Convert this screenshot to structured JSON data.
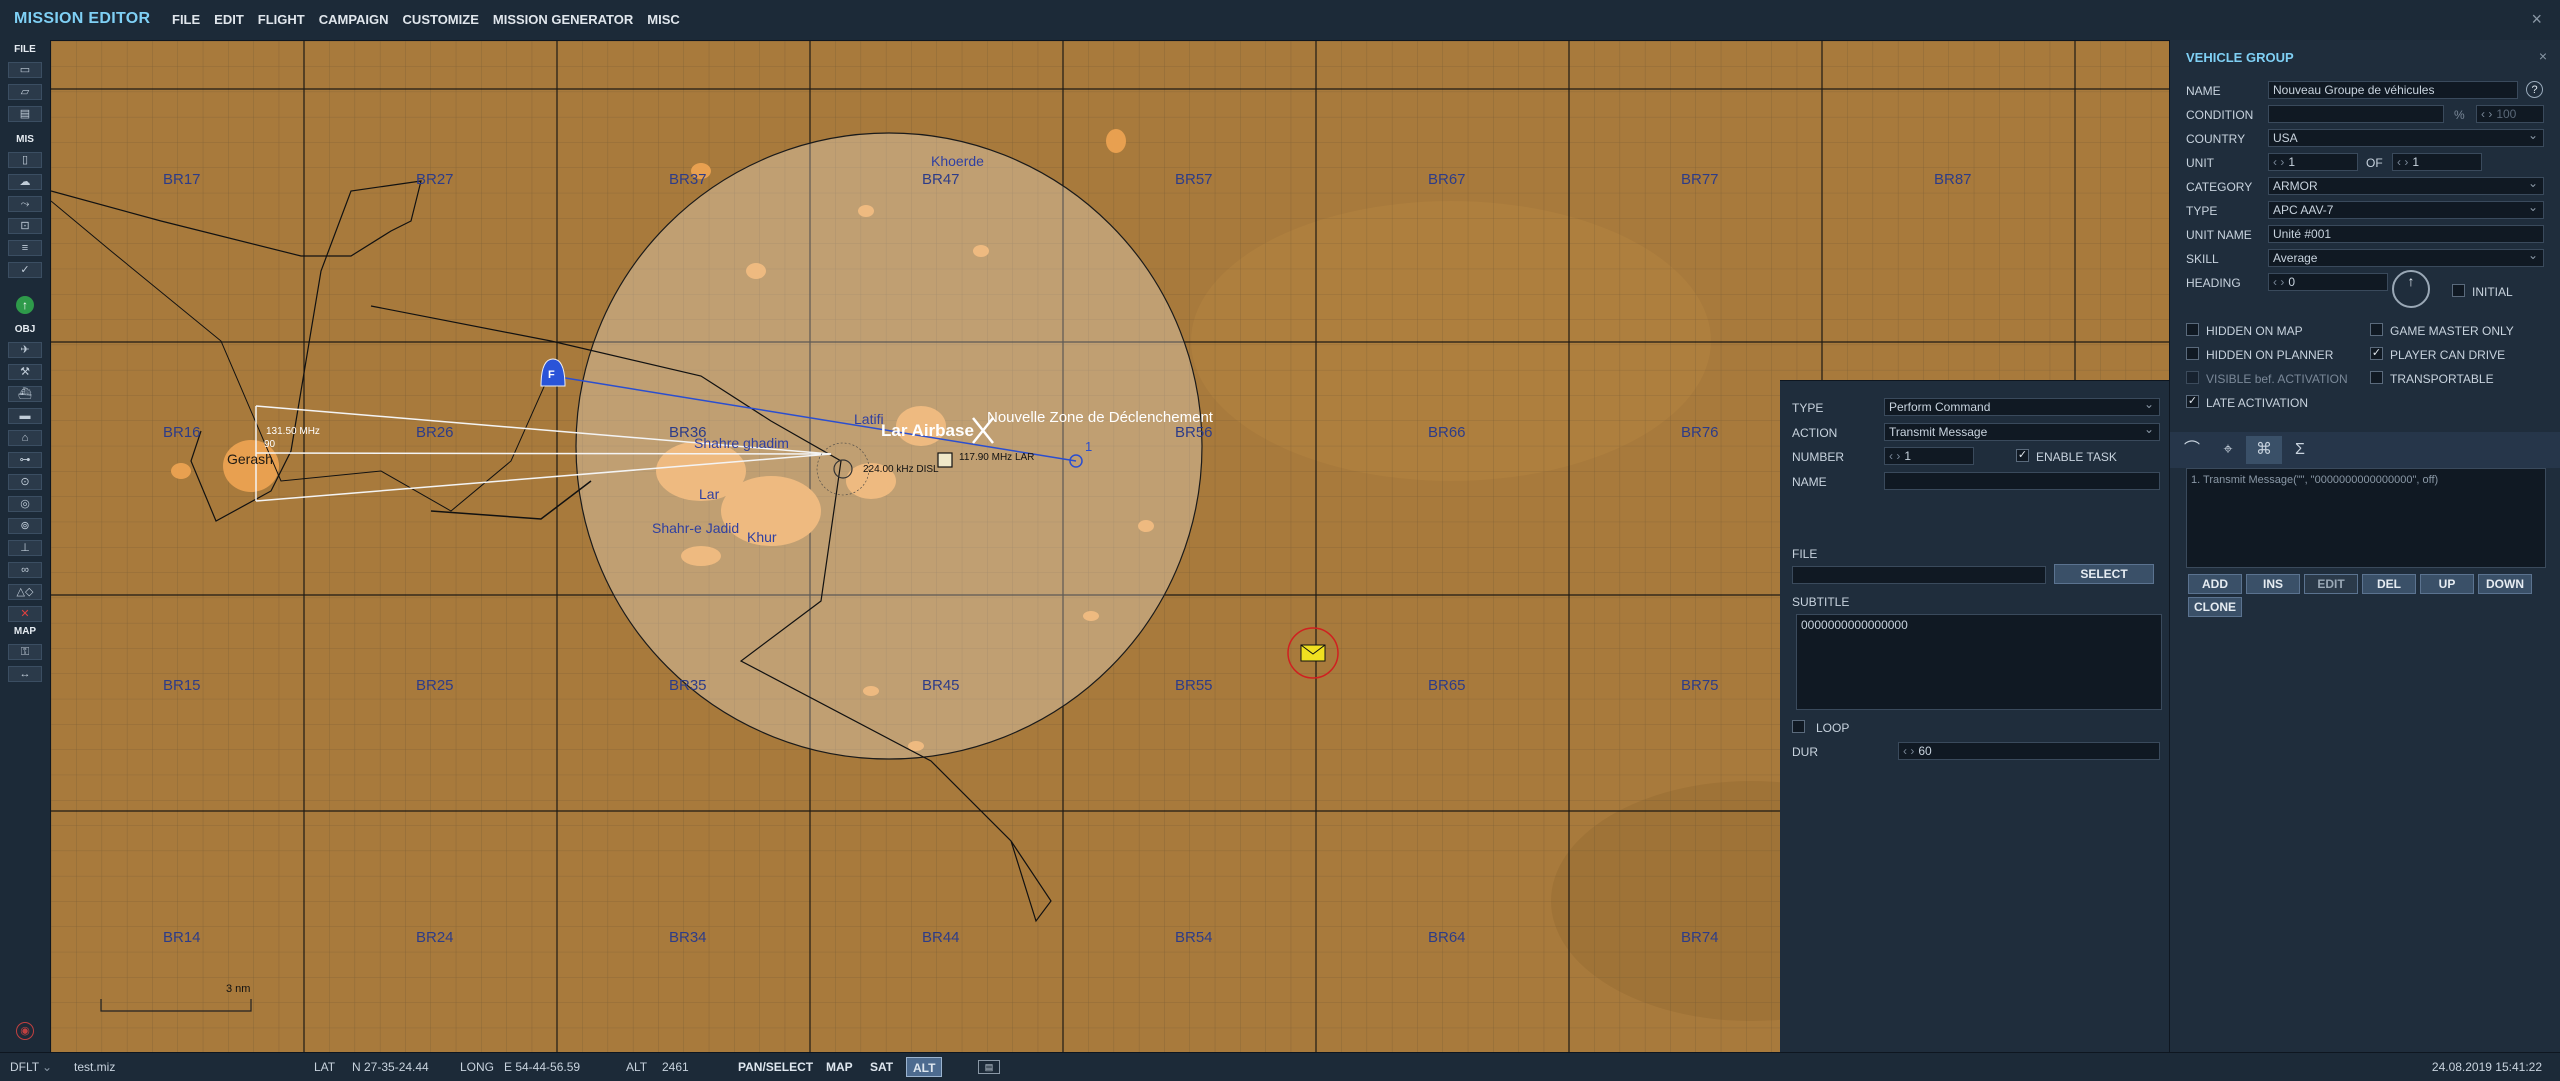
{
  "app": {
    "title": "MISSION EDITOR",
    "close": "×"
  },
  "menu": [
    "FILE",
    "EDIT",
    "FLIGHT",
    "CAMPAIGN",
    "CUSTOMIZE",
    "MISSION GENERATOR",
    "MISC"
  ],
  "toolbar": {
    "sections": [
      "FILE",
      "MIS",
      "OBJ",
      "MAP"
    ]
  },
  "map": {
    "grid_labels": [
      "BR17",
      "BR27",
      "BR37",
      "BR47",
      "BR57",
      "BR67",
      "BR77",
      "BR87",
      "BR16",
      "BR26",
      "BR36",
      "BR56",
      "BR66",
      "BR76",
      "BR15",
      "BR25",
      "BR35",
      "BR45",
      "BR55",
      "BR65",
      "BR75",
      "BR14",
      "BR24",
      "BR34",
      "BR44",
      "BR54",
      "BR64",
      "BR74"
    ],
    "places": {
      "khoerde": "Khoerde",
      "latifi": "Latifi",
      "shahre_ghadim": "Shahre ghadim",
      "lar": "Lar",
      "shahr_e_jadid": "Shahr-e Jadid",
      "khur": "Khur",
      "gerash": "Gerash"
    },
    "airbase": "Lar Airbase",
    "trigger_zone": "Nouvelle Zone de Déclenchement",
    "freq_gerash": "131.50 MHz",
    "freq_ndb": "224.00 kHz DISL",
    "freq_lar": "117.90 MHz LAR",
    "waypoint": "1",
    "unit_marker": "F",
    "heading_label": "90",
    "scale": "3 nm"
  },
  "status": {
    "profile": "DFLT",
    "file": "test.miz",
    "lat_label": "LAT",
    "lat": "N 27-35-24.44",
    "long_label": "LONG",
    "long": "E 54-44-56.59",
    "alt_label": "ALT",
    "alt": "2461",
    "modes": [
      "PAN/SELECT",
      "MAP",
      "SAT",
      "ALT"
    ],
    "datetime": "24.08.2019 15:41:22"
  },
  "vehicle_group": {
    "title": "VEHICLE GROUP",
    "name_label": "NAME",
    "name": "Nouveau Groupe de véhicules",
    "help": "?",
    "condition_label": "CONDITION",
    "condition_pct": "%",
    "condition_value": "100",
    "country_label": "COUNTRY",
    "country": "USA",
    "unit_label": "UNIT",
    "unit": "1",
    "of_label": "OF",
    "of": "1",
    "category_label": "CATEGORY",
    "category": "ARMOR",
    "type_label": "TYPE",
    "type": "APC AAV-7",
    "unit_name_label": "UNIT NAME",
    "unit_name": "Unité #001",
    "skill_label": "SKILL",
    "skill": "Average",
    "heading_label": "HEADING",
    "heading": "0",
    "initial_label": "INITIAL",
    "hidden_on_map": "HIDDEN ON MAP",
    "game_master_only": "GAME MASTER ONLY",
    "hidden_on_planner": "HIDDEN ON PLANNER",
    "player_can_drive": "PLAYER CAN DRIVE",
    "visible_bef_activation": "VISIBLE bef. ACTIVATION",
    "transportable": "TRANSPORTABLE",
    "late_activation": "LATE ACTIVATION",
    "action_list": [
      "1. Transmit Message(\"\", \"0000000000000000\", off)"
    ],
    "buttons": [
      "ADD",
      "INS",
      "EDIT",
      "DEL",
      "UP",
      "DOWN",
      "CLONE"
    ]
  },
  "command": {
    "type_label": "TYPE",
    "type": "Perform Command",
    "action_label": "ACTION",
    "action": "Transmit Message",
    "number_label": "NUMBER",
    "number": "1",
    "enable_task": "ENABLE TASK",
    "name_label": "NAME",
    "name": "",
    "file_label": "FILE",
    "select": "SELECT",
    "subtitle_label": "SUBTITLE",
    "subtitle": "0000000000000000",
    "loop_label": "LOOP",
    "dur_label": "DUR",
    "dur": "60"
  },
  "colors": {
    "accent": "#7fd0f5",
    "terrain": "#a87a3c",
    "panel": "#1f2d3c",
    "grid_text": "#2d3c88"
  }
}
